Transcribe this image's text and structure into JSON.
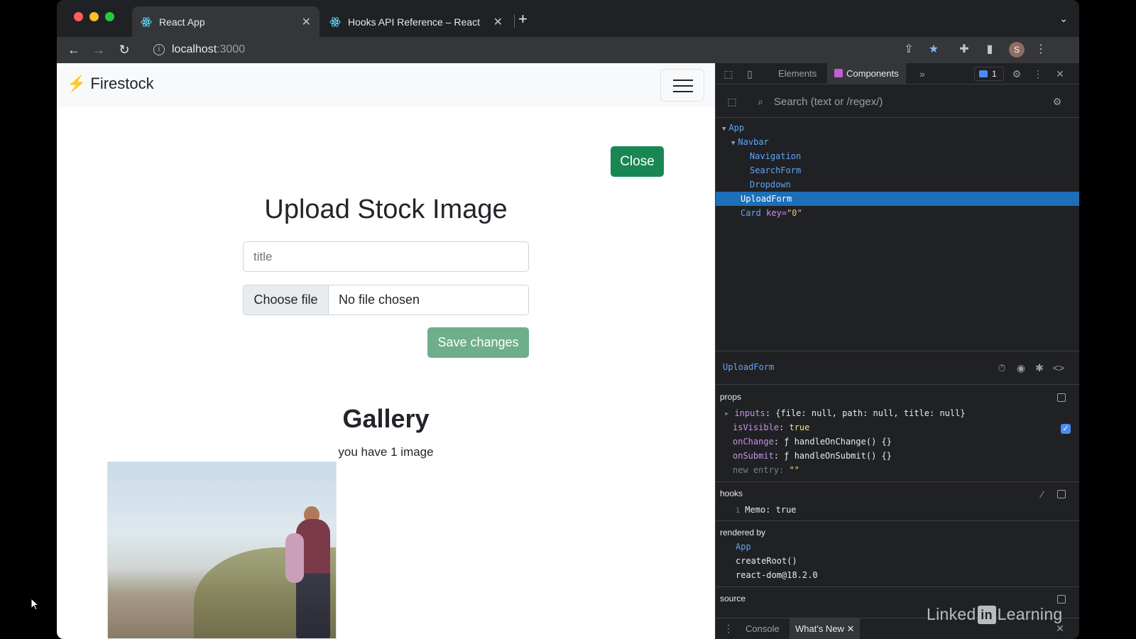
{
  "browser": {
    "tabs": [
      {
        "title": "React App",
        "active": true
      },
      {
        "title": "Hooks API Reference – React",
        "active": false
      }
    ],
    "new_tab_label": "+",
    "url_host": "localhost",
    "url_port": ":3000",
    "profile_initial": "S",
    "traffic_lights": {
      "close": "#ff5f57",
      "minimize": "#febc2e",
      "maximize": "#28c840"
    }
  },
  "app": {
    "brand": "Firestock",
    "close_button": "Close",
    "upload_title": "Upload Stock Image",
    "title_placeholder": "title",
    "choose_file_label": "Choose file",
    "file_status": "No file chosen",
    "save_button": "Save changes",
    "gallery_title": "Gallery",
    "gallery_count": "you have 1 image",
    "colors": {
      "success": "#198754",
      "success_disabled": "#6eae8a"
    }
  },
  "devtools": {
    "tabs": {
      "elements": "Elements",
      "components": "Components"
    },
    "issues_count": "1",
    "search_placeholder": "Search (text or /regex/)",
    "tree": {
      "app": "App",
      "navbar": "Navbar",
      "navigation": "Navigation",
      "searchform": "SearchForm",
      "dropdown": "Dropdown",
      "uploadform": "UploadForm",
      "card": "Card",
      "card_key_name": "key",
      "card_key_val": "\"0\""
    },
    "selected_component": "UploadForm",
    "props_label": "props",
    "props": {
      "inputs_key": "inputs",
      "inputs_val": "{file: null, path: null, title: null}",
      "isvisible_key": "isVisible",
      "isvisible_val": "true",
      "onchange_key": "onChange",
      "onchange_val": "ƒ handleOnChange() {}",
      "onsubmit_key": "onSubmit",
      "onsubmit_val": "ƒ handleOnSubmit() {}",
      "new_entry_key": "new entry",
      "new_entry_val": "\"\""
    },
    "hooks_label": "hooks",
    "hook_index": "1",
    "hook_text": "Memo: true",
    "rendered_by_label": "rendered by",
    "rendered_by": [
      "App",
      "createRoot()",
      "react-dom@18.2.0"
    ],
    "source_label": "source",
    "drawer": {
      "console": "Console",
      "whats_new": "What's New"
    }
  },
  "watermark": {
    "pre": "Linked",
    "in": "in",
    "post": "Learning"
  }
}
